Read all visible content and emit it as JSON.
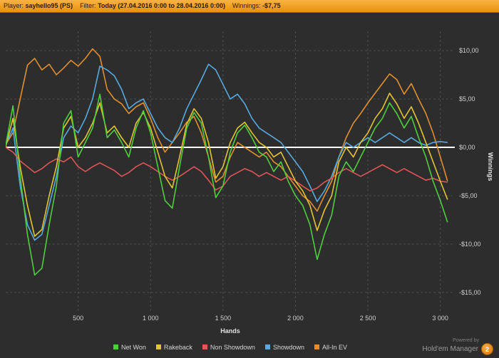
{
  "header": {
    "player_label": "Player:",
    "player_value": "sayhello95 (PS)",
    "filter_label": "Filter:",
    "filter_value": "Today (27.04.2016 0:00 to 28.04.2016 0:00)",
    "winnings_label": "Winnings:",
    "winnings_value": "-$7,75"
  },
  "chart_data": {
    "type": "line",
    "title": "",
    "xlabel": "Hands",
    "ylabel": "Winnings",
    "xlim": [
      0,
      3100
    ],
    "ylim": [
      -17,
      12
    ],
    "grid": true,
    "grid_color": "#4d4d4d",
    "zero_line_color": "#ffffff",
    "legend_position": "bottom",
    "xticks": [
      500,
      1000,
      1500,
      2000,
      2500,
      3000
    ],
    "xtick_labels": [
      "500",
      "1 000",
      "1 500",
      "2 000",
      "2 500",
      "3 000"
    ],
    "yticks": [
      10,
      5,
      0,
      -5,
      -10,
      -15
    ],
    "ytick_labels": [
      "$10,00",
      "$5,00",
      "$0,00",
      "-$5,00",
      "-$10,00",
      "-$15,00"
    ],
    "x": [
      0,
      50,
      100,
      150,
      200,
      250,
      300,
      350,
      400,
      450,
      500,
      550,
      600,
      650,
      700,
      750,
      800,
      850,
      900,
      950,
      1000,
      1050,
      1100,
      1150,
      1200,
      1250,
      1300,
      1350,
      1400,
      1450,
      1500,
      1550,
      1600,
      1650,
      1700,
      1750,
      1800,
      1850,
      1900,
      1950,
      2000,
      2050,
      2100,
      2150,
      2200,
      2250,
      2300,
      2350,
      2400,
      2450,
      2500,
      2550,
      2600,
      2650,
      2700,
      2750,
      2800,
      2850,
      2900,
      2950,
      3000,
      3050
    ],
    "series": [
      {
        "name": "Net Won",
        "color": "#4ece3d",
        "values": [
          0.2,
          4.3,
          -3,
          -9,
          -13.2,
          -12.5,
          -8,
          -4,
          2.5,
          3.8,
          -1,
          0.5,
          2,
          5.5,
          1,
          1.8,
          0.5,
          -1,
          2,
          3.8,
          1.5,
          -2,
          -5.5,
          -6.3,
          -2,
          2,
          3.6,
          2.5,
          -1,
          -5.2,
          -4,
          -0.5,
          1.5,
          2.3,
          1,
          -0.5,
          -1,
          -2.5,
          -1.5,
          -3.5,
          -5,
          -6,
          -8,
          -11.6,
          -9,
          -7,
          -3,
          -1.5,
          -2.5,
          -1,
          0.5,
          2,
          3,
          4.6,
          3.5,
          2,
          3.2,
          1,
          -1,
          -3.5,
          -5.5,
          -7.75
        ]
      },
      {
        "name": "Rakeback",
        "color": "#e3c431",
        "values": [
          0.1,
          3,
          -2,
          -6,
          -9.2,
          -8.5,
          -5,
          -2,
          2,
          3.2,
          0,
          1,
          2.5,
          4.6,
          1.5,
          2.2,
          1,
          0,
          2.5,
          3.6,
          2,
          -0.5,
          -3,
          -4.2,
          -1,
          2.4,
          4,
          3,
          0.5,
          -3.2,
          -2,
          0.5,
          2,
          2.6,
          1.5,
          0.5,
          0,
          -1,
          -0.5,
          -2,
          -3.5,
          -4.5,
          -6,
          -8.6,
          -6.5,
          -5,
          -1.5,
          0,
          -1,
          0.5,
          1.5,
          3,
          4,
          5.6,
          4.5,
          3,
          4.2,
          2.5,
          0.5,
          -1.5,
          -3.5,
          -5.4
        ]
      },
      {
        "name": "Non Showdown",
        "color": "#e05555",
        "values": [
          0,
          -0.5,
          -1.4,
          -2,
          -2.6,
          -2.2,
          -1.6,
          -1.2,
          -1.5,
          -1,
          -2,
          -2.5,
          -2,
          -1.6,
          -2,
          -2.4,
          -3,
          -2.6,
          -2,
          -1.6,
          -2,
          -2.5,
          -3,
          -3.4,
          -3,
          -2.5,
          -2,
          -2.5,
          -3.4,
          -4.4,
          -4,
          -3,
          -2.6,
          -2.2,
          -2.5,
          -3,
          -2.6,
          -3,
          -3.4,
          -3,
          -3.5,
          -4,
          -4.5,
          -4.2,
          -3.6,
          -3.2,
          -2.6,
          -2.2,
          -2.6,
          -3,
          -2.6,
          -2.2,
          -1.8,
          -2.2,
          -2.6,
          -2.2,
          -2.6,
          -3,
          -3.4,
          -3.2,
          -3.5,
          -3.6
        ]
      },
      {
        "name": "Showdown",
        "color": "#55aae0",
        "values": [
          0.2,
          2,
          -4,
          -8,
          -9.6,
          -9,
          -6,
          -3,
          1,
          2.2,
          1.5,
          3,
          5,
          8.4,
          8,
          7.4,
          6,
          4,
          4.6,
          5,
          3.5,
          2,
          1,
          0.5,
          2,
          4,
          5.5,
          7,
          8.6,
          8,
          6.5,
          5,
          5.5,
          4.5,
          3,
          2,
          1.5,
          1,
          0.5,
          -0.5,
          -1.5,
          -2.5,
          -4,
          -5.6,
          -4.5,
          -3,
          -1,
          0.5,
          0,
          0.5,
          1,
          0.5,
          1,
          1.5,
          1,
          0.5,
          1,
          0.5,
          0.2,
          0.5,
          0.6,
          0.5
        ]
      },
      {
        "name": "All-In EV",
        "color": "#e08f2e",
        "values": [
          0.3,
          1.5,
          5,
          8.5,
          9.2,
          8,
          8.6,
          7.5,
          8.2,
          9,
          8.4,
          9.2,
          10.2,
          9.4,
          6,
          5,
          4.5,
          3.5,
          4.2,
          4.6,
          3,
          1,
          -0.5,
          0.5,
          1.5,
          2.6,
          3.2,
          1.5,
          -1,
          -3.6,
          -3,
          -1,
          0.5,
          0,
          -0.5,
          -1,
          -0.5,
          -1.5,
          -2,
          -3,
          -4,
          -5,
          -5.6,
          -6.6,
          -5,
          -3.5,
          -1,
          1,
          2.5,
          3.5,
          4.6,
          5.6,
          6.6,
          7.6,
          7,
          5.5,
          6.6,
          5,
          3.5,
          1.5,
          -1,
          -3.5
        ]
      }
    ]
  },
  "footer": {
    "powered_by": "Powered by",
    "brand": "Hold'em Manager",
    "badge_text": "2"
  }
}
